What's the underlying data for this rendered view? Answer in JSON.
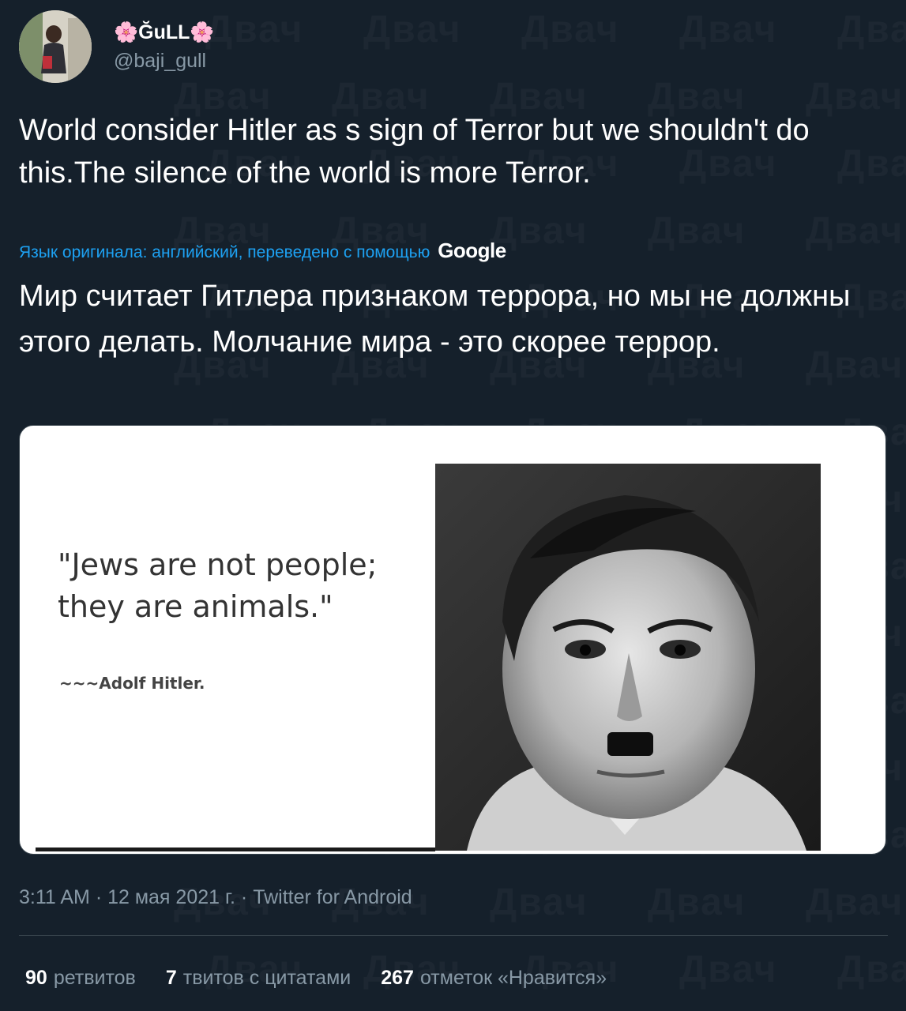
{
  "user": {
    "display_name": "ĞuLL",
    "flower_left": "🌸",
    "flower_right": "🌸",
    "handle": "@baji_gull"
  },
  "tweet": {
    "text": "World consider Hitler as s sign of Terror but we shouldn't do this.The silence of the world is more Terror.",
    "translate_note": "Язык оригинала: английский, переведено с помощью",
    "translate_brand": "Google",
    "translated_text": "Мир считает Гитлера признаком террора, но мы не должны этого делать. Молчание мира - это скорее террор."
  },
  "media": {
    "quote": "\"Jews are not people; they are animals.\"",
    "attribution": "~~~Adolf Hitler."
  },
  "meta": {
    "timestamp": "3:11 AM · 12 мая 2021 г. · Twitter for Android"
  },
  "stats": {
    "retweets_count": "90",
    "retweets_label": "ретвитов",
    "quotes_count": "7",
    "quotes_label": "твитов с цитатами",
    "likes_count": "267",
    "likes_label": "отметок «Нравится»"
  },
  "watermark_text": "Двач",
  "colors": {
    "background": "#15202b",
    "link": "#1da1f2",
    "secondary": "#8899a6"
  }
}
